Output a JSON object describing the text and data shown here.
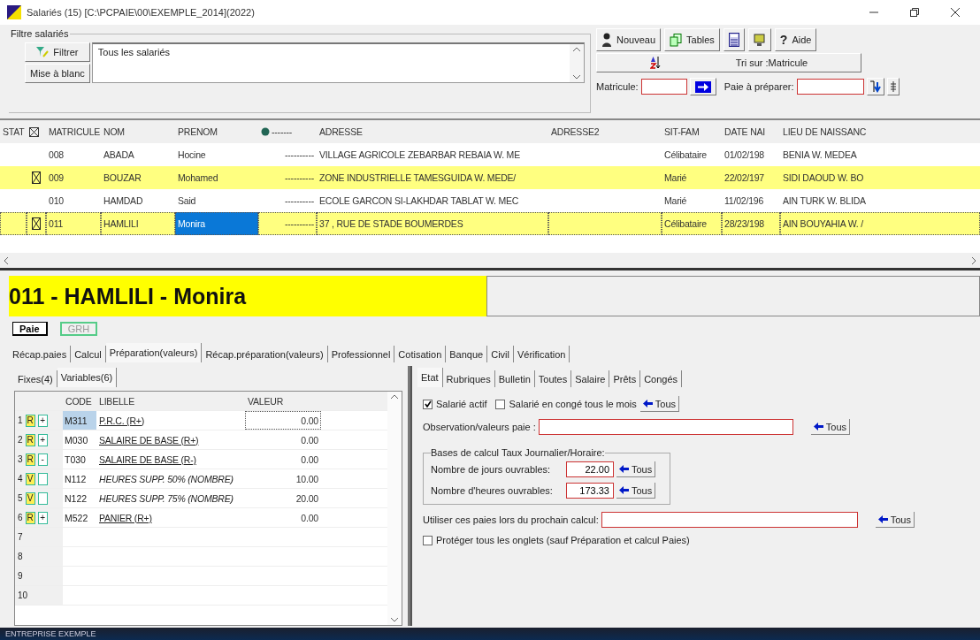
{
  "window": {
    "title": "Salariés (15) [C:\\PCPAIE\\00\\EXEMPLE_2014](2022)"
  },
  "filter": {
    "legend": "Filtre salariés",
    "filter_button": "Filtrer",
    "reset_button": "Mise à blanc",
    "value": "Tous les salariés"
  },
  "toolbar": {
    "buttons": [
      {
        "kind": "person",
        "label": "Nouveau"
      },
      {
        "kind": "docs",
        "label": "Tables"
      },
      {
        "kind": "calc"
      },
      {
        "kind": "monitor"
      },
      {
        "kind": "help",
        "label": "Aide",
        "glyph": "?"
      }
    ],
    "sort_button": "Tri sur :Matricule",
    "matricule_label": "Matricule:",
    "paie_label": "Paie à préparer:"
  },
  "table": {
    "stat_header": "STAT",
    "columns": [
      "MATRICULE",
      "NOM",
      "PRENOM",
      "-------",
      "ADRESSE",
      "ADRESSE2",
      "SIT-FAM",
      "DATE NAI",
      "LIEU DE NAISSANC"
    ],
    "rows": [
      {
        "checked": false,
        "selected": false,
        "cells": [
          "008",
          "ABADA",
          "Hocine",
          "----------",
          "VILLAGE AGRICOLE ZEBARBAR REBAIA W. ME",
          "",
          "Célibataire",
          "01/02/198",
          "BENIA W. MEDEA"
        ]
      },
      {
        "checked": true,
        "selected": false,
        "cells": [
          "009",
          "BOUZAR",
          "Mohamed",
          "----------",
          "ZONE INDUSTRIELLE TAMESGUIDA W. MEDE/",
          "",
          "Marié",
          "22/02/197",
          "SIDI DAOUD W. BO"
        ]
      },
      {
        "checked": false,
        "selected": false,
        "cells": [
          "010",
          "HAMDAD",
          "Said",
          "----------",
          "ECOLE GARCON SI-LAKHDAR TABLAT W. MEC",
          "",
          "Marié",
          "11/02/196",
          "AIN TURK W. BLIDA"
        ]
      },
      {
        "checked": true,
        "selected": true,
        "cells": [
          "011",
          "HAMLILI",
          "Monira",
          "----------",
          "37 , RUE DE STADE  BOUMERDES",
          "",
          "Célibataire",
          "28/23/198",
          "AIN BOUYAHIA W. /"
        ]
      }
    ]
  },
  "employee": {
    "heading": "011 - HAMLILI - Monira"
  },
  "mode_tabs": [
    {
      "label": "Paie",
      "selected": true
    },
    {
      "label": "GRH",
      "selected": false
    }
  ],
  "tabs": [
    {
      "label": "Récap.paies",
      "selected": false
    },
    {
      "label": "Calcul",
      "selected": false
    },
    {
      "label": "Préparation(valeurs)",
      "selected": true
    },
    {
      "label": "Récap.préparation(valeurs)",
      "selected": false
    },
    {
      "label": "Professionnel",
      "selected": false
    },
    {
      "label": "Cotisation",
      "selected": false
    },
    {
      "label": "Banque",
      "selected": false
    },
    {
      "label": "Civil",
      "selected": false
    },
    {
      "label": "Vérification",
      "selected": false
    }
  ],
  "left_tabs": [
    {
      "label": "Fixes(4)",
      "selected": false
    },
    {
      "label": "Variables(6)",
      "selected": true
    }
  ],
  "variables": {
    "columns": [
      "CODE",
      "LIBELLE",
      "VALEUR"
    ],
    "rows": [
      {
        "num": "1",
        "kind": "rubrique",
        "badge": "R",
        "sign": "+",
        "code": "M311",
        "label": "P.R.C. (R+)",
        "value": "0.00",
        "selected": true
      },
      {
        "num": "2",
        "kind": "rubrique",
        "badge": "R",
        "sign": "+",
        "code": "M030",
        "label": "SALAIRE DE BASE (R+)",
        "value": "0.00",
        "selected": false
      },
      {
        "num": "3",
        "kind": "rubrique",
        "badge": "R",
        "sign": "-",
        "code": "T030",
        "label": "SALAIRE DE BASE (R-)",
        "value": "0.00",
        "selected": false
      },
      {
        "num": "4",
        "kind": "variable",
        "badge": "V",
        "code": "N112",
        "label": "HEURES SUPP.  50% (NOMBRE)",
        "value": "10.00",
        "selected": false
      },
      {
        "num": "5",
        "kind": "variable",
        "badge": "V",
        "code": "N122",
        "label": "HEURES SUPP.  75% (NOMBRE)",
        "value": "20.00",
        "selected": false
      },
      {
        "num": "6",
        "kind": "rubrique",
        "badge": "R",
        "sign": "+",
        "code": "M522",
        "label": "PANIER (R+)",
        "value": "0.00",
        "selected": false
      },
      {
        "num": "7",
        "kind": "empty"
      },
      {
        "num": "8",
        "kind": "empty"
      },
      {
        "num": "9",
        "kind": "empty"
      },
      {
        "num": "10",
        "kind": "empty"
      }
    ]
  },
  "right_tabs": [
    {
      "label": "Etat",
      "selected": true
    },
    {
      "label": "Rubriques",
      "selected": false
    },
    {
      "label": "Bulletin",
      "selected": false
    },
    {
      "label": "Toutes",
      "selected": false
    },
    {
      "label": "Salaire",
      "selected": false
    },
    {
      "label": "Prêts",
      "selected": false
    },
    {
      "label": "Congés",
      "selected": false
    }
  ],
  "etat": {
    "actif": {
      "label": "Salarié actif",
      "checked": true
    },
    "conge": {
      "label": "Salarié en congé tous le mois",
      "checked": false
    },
    "all_buttons": [
      "Tous",
      "Tous",
      "Tous",
      "Tous",
      "Tous"
    ],
    "observation_label": "Observation/valeurs paie :",
    "bases_legend": "Bases de calcul Taux Journalier/Horaire:",
    "jours_label": "Nombre de jours ouvrables:",
    "jours_value": "22.00",
    "heures_label": "Nombre d'heures ouvrables:",
    "heures_value": "173.33",
    "utiliser_label": "Utiliser ces paies lors du prochain calcul:",
    "proteger": {
      "label": "Protéger tous les onglets (sauf Préparation et calcul Paies)",
      "checked": false
    }
  },
  "status_bar": {
    "text": "ENTREPRISE EXEMPLE"
  }
}
